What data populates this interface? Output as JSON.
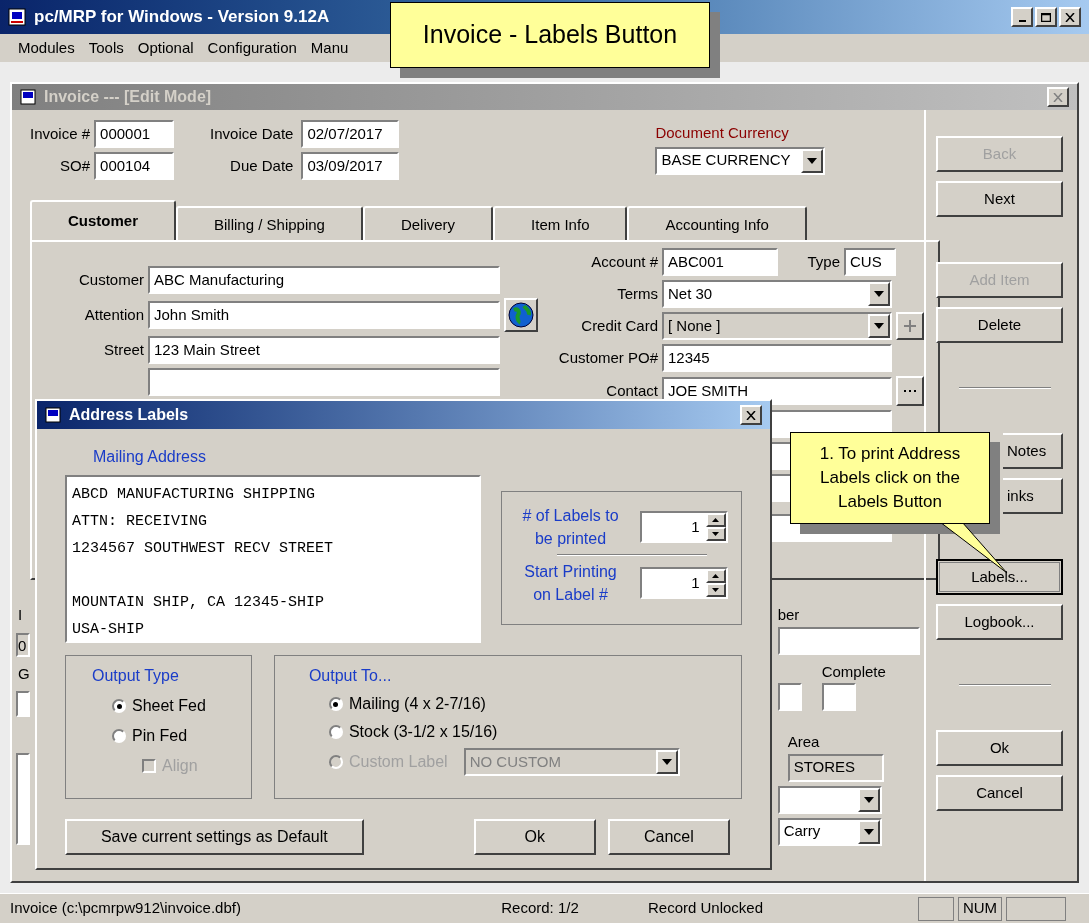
{
  "app_window": {
    "title": "pc/MRP for Windows - Version 9.12A"
  },
  "menu": [
    "Modules",
    "Tools",
    "Optional",
    "Configuration",
    "Manu"
  ],
  "title_callout": {
    "text": "Invoice - Labels Button"
  },
  "invoice_window": {
    "title": "Invoice --- [Edit Mode]"
  },
  "header": {
    "invoice_no": {
      "label": "Invoice #",
      "value": "000001"
    },
    "so_no": {
      "label": "SO#",
      "value": "000104"
    },
    "invoice_date": {
      "label": "Invoice Date",
      "value": "02/07/2017"
    },
    "due_date": {
      "label": "Due Date",
      "value": "03/09/2017"
    },
    "currency": {
      "label": "Document Currency",
      "value": "BASE CURRENCY"
    }
  },
  "tabs": [
    {
      "label": "Customer",
      "selected": true
    },
    {
      "label": "Billing / Shipping",
      "selected": false
    },
    {
      "label": "Delivery",
      "selected": false
    },
    {
      "label": "Item Info",
      "selected": false
    },
    {
      "label": "Accounting Info",
      "selected": false
    }
  ],
  "customer_fields": [
    {
      "label": "Customer",
      "value": "ABC Manufacturing"
    },
    {
      "label": "Attention",
      "value": "John Smith"
    },
    {
      "label": "Street",
      "value": "123 Main Street"
    }
  ],
  "account": {
    "label": "Account #",
    "value": "ABC001",
    "type_label": "Type",
    "type_value": "CUS"
  },
  "terms": {
    "label": "Terms",
    "value": "Net 30"
  },
  "credit_card": {
    "label": "Credit Card",
    "value": "[ None ]",
    "disabled": true
  },
  "customer_po": {
    "label": "Customer PO#",
    "value": "12345"
  },
  "contact": {
    "label": "Contact",
    "value": "JOE SMITH"
  },
  "lower_left": [
    {
      "kind": "label",
      "text": "I"
    },
    {
      "kind": "field",
      "text": "0"
    },
    {
      "kind": "label",
      "text": "G"
    }
  ],
  "lower_right": {
    "number_label": "ber",
    "complete_label": "Complete",
    "area_label": "Area",
    "area_value": "STORES",
    "carry_value": "Carry"
  },
  "side_buttons": [
    {
      "kind": "button",
      "label": "Back",
      "disabled": true,
      "focused": false
    },
    {
      "kind": "button",
      "label": "Next",
      "disabled": false,
      "focused": false
    },
    {
      "kind": "gap"
    },
    {
      "kind": "button",
      "label": "Add Item",
      "disabled": true,
      "focused": false
    },
    {
      "kind": "button",
      "label": "Delete",
      "disabled": false,
      "focused": false
    },
    {
      "kind": "rule"
    },
    {
      "kind": "covered_button",
      "label": "Notes",
      "disabled": false,
      "focused": false
    },
    {
      "kind": "covered_button",
      "label": "inks",
      "disabled": false,
      "focused": false
    },
    {
      "kind": "gap"
    },
    {
      "kind": "button",
      "label": "Labels...",
      "disabled": false,
      "focused": true
    },
    {
      "kind": "button",
      "label": "Logbook...",
      "disabled": false,
      "focused": false
    },
    {
      "kind": "rule"
    },
    {
      "kind": "button",
      "label": "Ok",
      "disabled": false,
      "focused": false
    },
    {
      "kind": "button",
      "label": "Cancel",
      "disabled": false,
      "focused": false
    }
  ],
  "dialog": {
    "title": "Address Labels",
    "mailing_label": "Mailing Address",
    "address": "ABCD MANUFACTURING SHIPPING\nATTN: RECEIVING\n1234567 SOUTHWEST RECV STREET\n\nMOUNTAIN SHIP, CA 12345-SHIP\nUSA-SHIP",
    "label_count": {
      "label": "# of Labels to be printed",
      "value": "1"
    },
    "start_label": {
      "label": "Start Printing on Label #",
      "value": "1"
    },
    "output_type": {
      "title": "Output Type",
      "options": [
        {
          "label": "Sheet Fed",
          "selected": true
        },
        {
          "label": "Pin Fed",
          "selected": false
        }
      ],
      "align": {
        "label": "Align",
        "checked": false,
        "disabled": true
      }
    },
    "output_to": {
      "title": "Output To...",
      "options": [
        {
          "label": "Mailing (4 x 2-7/16)",
          "selected": true,
          "disabled": false
        },
        {
          "label": "Stock (3-1/2 x 15/16)",
          "selected": false,
          "disabled": false
        },
        {
          "label": "Custom Label",
          "selected": false,
          "disabled": true
        }
      ],
      "custom_value": "NO CUSTOM"
    },
    "buttons": [
      "Save current settings as Default",
      "Ok",
      "Cancel"
    ]
  },
  "step_callout": {
    "text": "1. To print Address Labels click on the Labels Button"
  },
  "status_bar": [
    {
      "kind": "text",
      "text": "Invoice (c:\\pcmrpw912\\invoice.dbf)"
    },
    {
      "kind": "center",
      "text": "Record: 1/2"
    },
    {
      "kind": "text",
      "text": "Record Unlocked"
    },
    {
      "kind": "pane"
    },
    {
      "kind": "pane",
      "text": "NUM"
    },
    {
      "kind": "pane"
    }
  ]
}
